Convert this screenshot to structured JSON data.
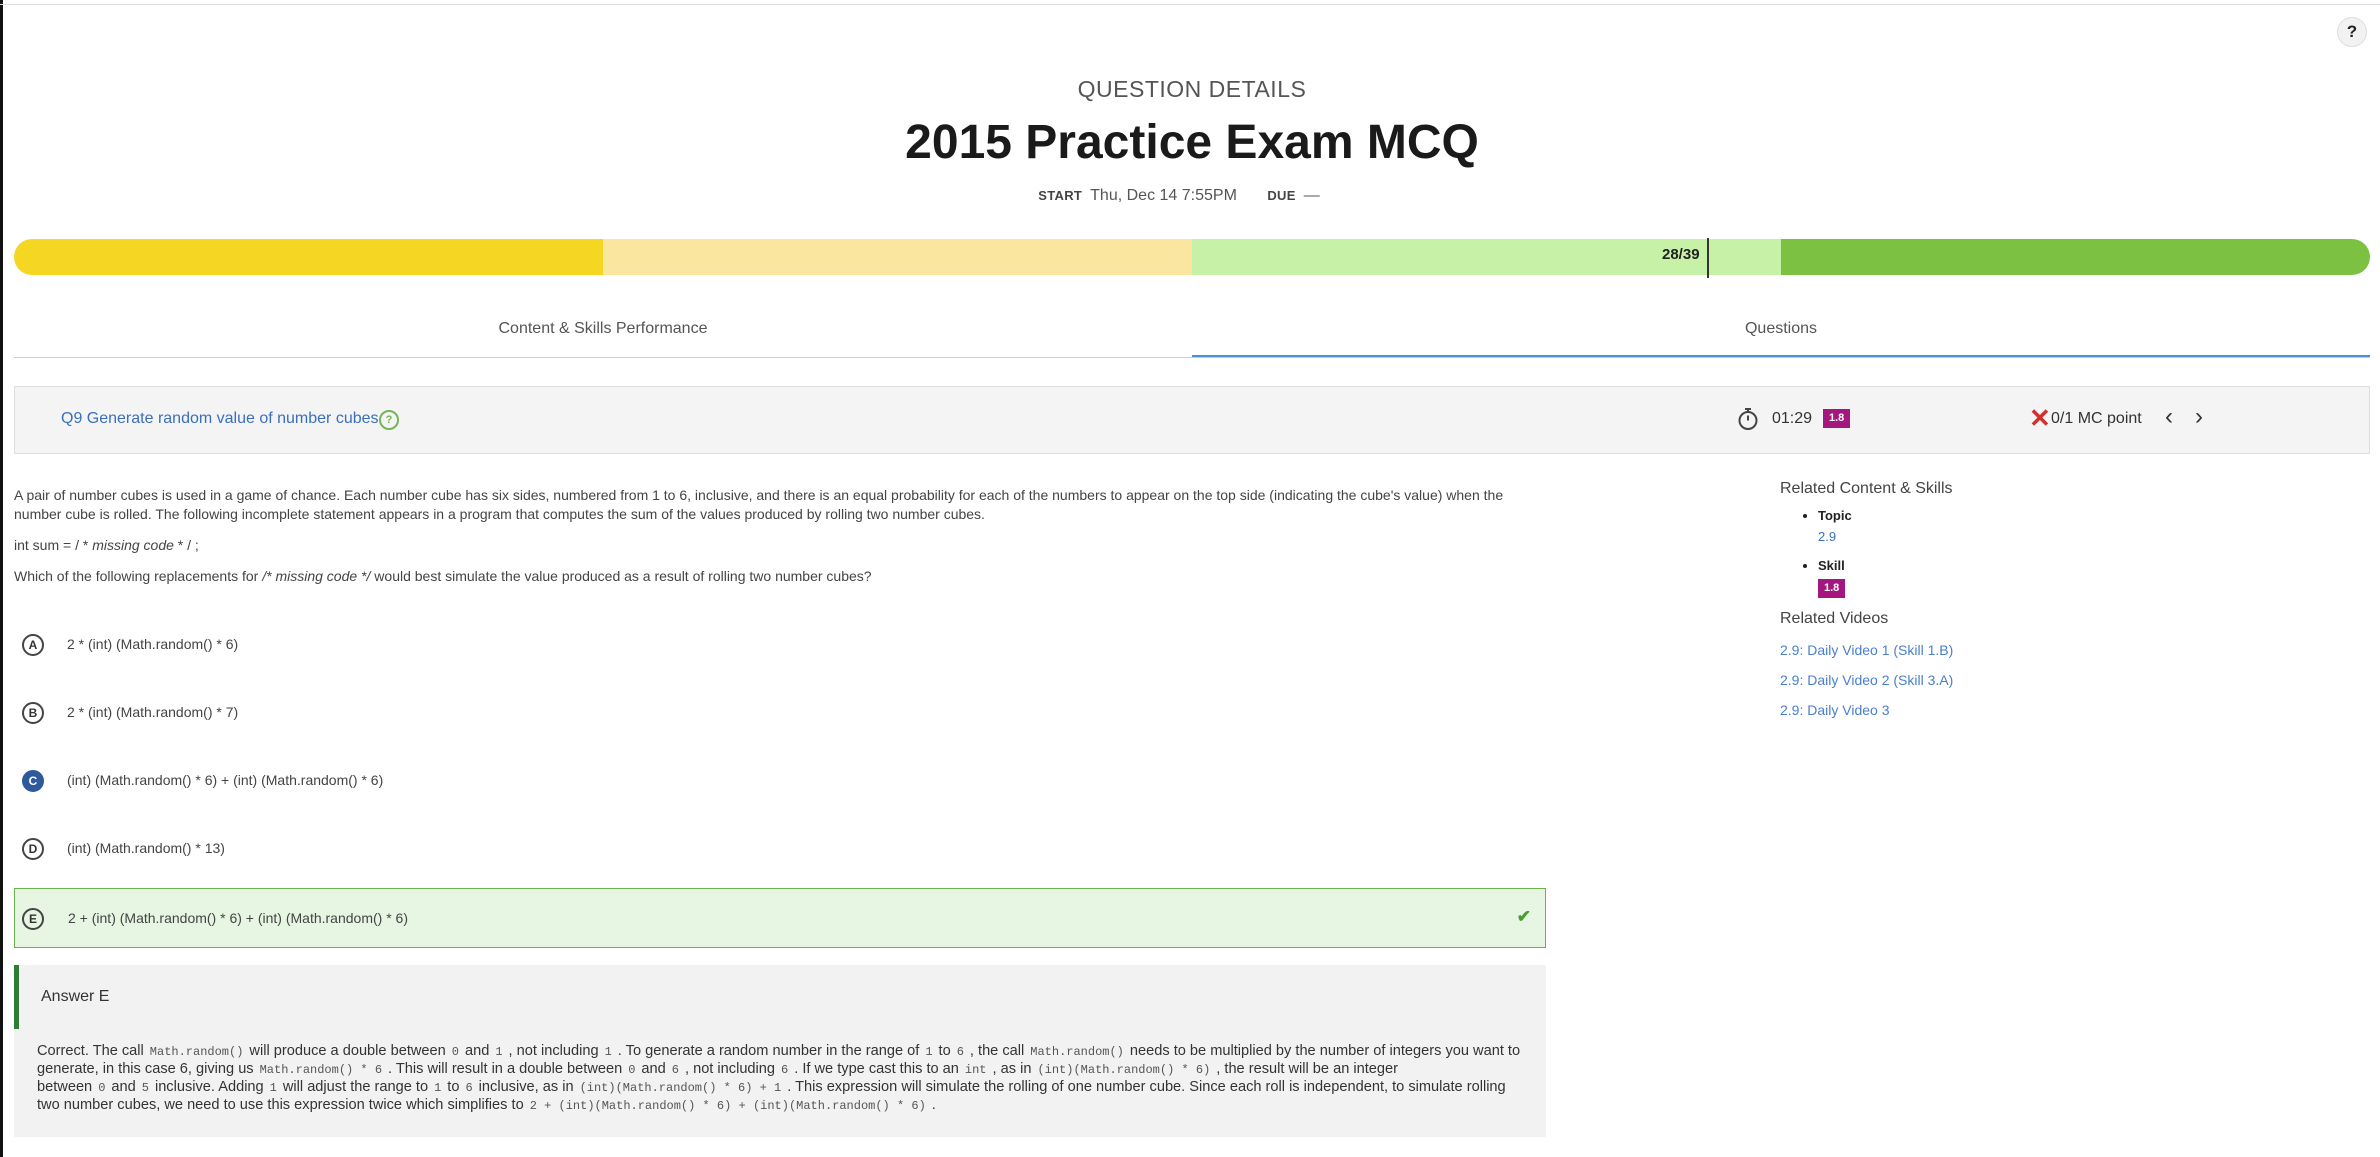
{
  "help_label": "?",
  "header": {
    "eyebrow": "QUESTION DETAILS",
    "title": "2015 Practice Exam MCQ",
    "start_label": "START",
    "start_value": "Thu, Dec 14 7:55PM",
    "due_label": "DUE",
    "due_value": "—"
  },
  "progress": {
    "label": "28/39",
    "marker_fraction": 0.718,
    "segments": [
      {
        "fraction": 0.25,
        "color": "#f4d623"
      },
      {
        "fraction": 0.25,
        "color": "#fae69e"
      },
      {
        "fraction": 0.25,
        "color": "#c8f1a8"
      },
      {
        "fraction": 0.25,
        "color": "#7cc142"
      }
    ]
  },
  "tabs": [
    {
      "label": "Content & Skills Performance",
      "active": false
    },
    {
      "label": "Questions",
      "active": true
    }
  ],
  "question": {
    "title": "Q9 Generate random value of number cubes",
    "time": "01:29",
    "skill_badge": "1.8",
    "points": "0/1 MC point"
  },
  "stem": {
    "para1": "A pair of number cubes is used in a game of chance. Each number cube has six sides, numbered from 1 to 6, inclusive, and there is an equal probability for each of the numbers to appear on the top side (indicating the cube's value) when the number cube is rolled. The following incomplete statement appears in a program that computes the sum of the values produced by rolling two number cubes.",
    "code_prefix": "int sum = / * ",
    "code_italic": "missing code",
    "code_suffix": " * / ;",
    "q_prefix": "Which of the following replacements for ",
    "q_italic": "/* missing code */",
    "q_suffix": " would best simulate the value produced as a result of rolling two number cubes?"
  },
  "options": [
    {
      "letter": "A",
      "text": "2 * (int) (Math.random() * 6)"
    },
    {
      "letter": "B",
      "text": "2 * (int) (Math.random() * 7)"
    },
    {
      "letter": "C",
      "text": "(int) (Math.random() * 6) + (int) (Math.random() * 6)"
    },
    {
      "letter": "D",
      "text": "(int) (Math.random() * 13)"
    },
    {
      "letter": "E",
      "text": "2 + (int) (Math.random() * 6) + (int) (Math.random() * 6)"
    }
  ],
  "answer": {
    "title": "Answer E",
    "t1": "Correct. The call",
    "c1": "Math.random()",
    "t2": "will produce a double between",
    "c2": "0",
    "t3": "and",
    "c3": "1",
    "t4": ", not including",
    "c4": "1",
    "t5": ". To generate a random number in the range of",
    "c5": "1",
    "t6": "to",
    "c6": "6",
    "t7": ", the call",
    "c7": "Math.random()",
    "t8": "needs to be multiplied by the number of integers you want to generate, in this case 6, giving us",
    "c8": "Math.random() * 6",
    "t9": ". This will result in a double between",
    "c9": "0",
    "t10": "and",
    "c10": "6",
    "t11": ", not including",
    "c11": "6",
    "t12": ". If we type cast this to an",
    "c12": "int",
    "t13": ", as in",
    "c13": "(int)(Math.random() * 6)",
    "t14": ", the result will be an integer between",
    "c14": "0",
    "t15": "and",
    "c15": "5",
    "t16": "inclusive. Adding",
    "c16": "1",
    "t17": "will adjust the range to",
    "c17": "1",
    "t18": "to",
    "c18": "6",
    "t19": "inclusive, as in",
    "c19": "(int)(Math.random() * 6) + 1",
    "t20": ". This expression will simulate the rolling of one number cube. Since each roll is independent, to simulate rolling two number cubes, we need to use this expression twice which simplifies to",
    "c20": "2 + (int)(Math.random() * 6) + (int)(Math.random() * 6)",
    "t21": "."
  },
  "related": {
    "heading": "Related Content & Skills",
    "topic_label": "Topic",
    "topic_value": "2.9",
    "skill_label": "Skill",
    "skill_value": "1.8",
    "videos_heading": "Related Videos",
    "videos": [
      "2.9: Daily Video 1 (Skill 1.B)",
      "2.9: Daily Video 2 (Skill 3.A)",
      "2.9: Daily Video 3"
    ]
  }
}
